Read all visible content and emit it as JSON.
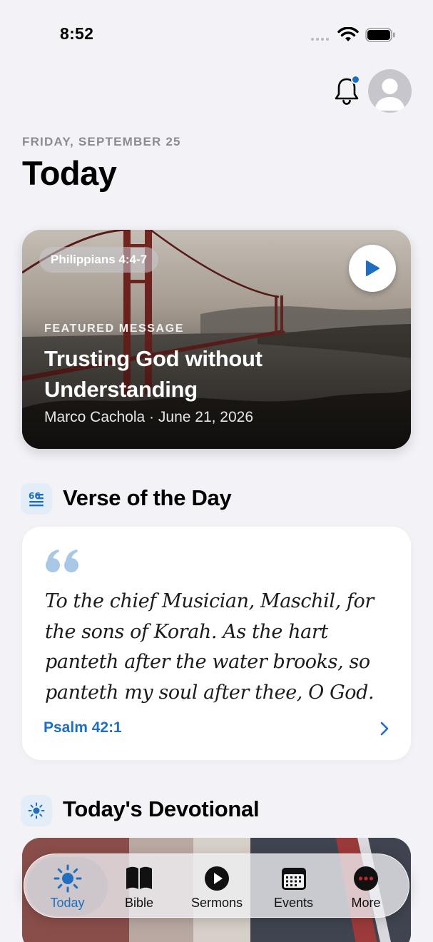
{
  "status_bar": {
    "time": "8:52"
  },
  "header": {
    "date": "FRIDAY, SEPTEMBER 25",
    "title": "Today"
  },
  "featured": {
    "reference_chip": "Philippians 4:4-7",
    "eyebrow": "FEATURED MESSAGE",
    "title": "Trusting God without Understanding",
    "meta": "Marco Cachola · June 21, 2026"
  },
  "verse_section": {
    "title": "Verse of the Day",
    "text": "To the chief Musician, Maschil, for the sons of Korah. As the hart panteth after the water brooks, so panteth my soul after thee, O God.",
    "reference": "Psalm 42:1"
  },
  "devotional_section": {
    "title": "Today's Devotional"
  },
  "tab_bar": {
    "tabs": [
      {
        "label": "Today",
        "icon": "sun-icon",
        "active": true
      },
      {
        "label": "Bible",
        "icon": "book-icon",
        "active": false
      },
      {
        "label": "Sermons",
        "icon": "play-circle-icon",
        "active": false
      },
      {
        "label": "Events",
        "icon": "calendar-icon",
        "active": false
      },
      {
        "label": "More",
        "icon": "ellipsis-circle-icon",
        "active": false
      }
    ]
  },
  "colors": {
    "accent": "#1f6fc0",
    "background": "#f2f2f7",
    "more_icon": "#c0262d"
  }
}
